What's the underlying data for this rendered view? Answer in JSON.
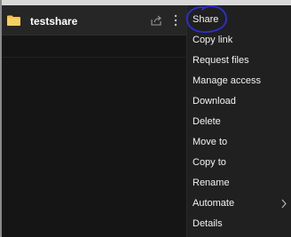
{
  "file_row": {
    "name": "testshare",
    "folder_icon": "folder-icon",
    "share_icon": "share-icon",
    "more_icon": "more-vertical-icon"
  },
  "menu": {
    "items": [
      {
        "label": "Share",
        "submenu": false
      },
      {
        "label": "Copy link",
        "submenu": false
      },
      {
        "label": "Request files",
        "submenu": false
      },
      {
        "label": "Manage access",
        "submenu": false
      },
      {
        "label": "Download",
        "submenu": false
      },
      {
        "label": "Delete",
        "submenu": false
      },
      {
        "label": "Move to",
        "submenu": false
      },
      {
        "label": "Copy to",
        "submenu": false
      },
      {
        "label": "Rename",
        "submenu": false
      },
      {
        "label": "Automate",
        "submenu": true
      },
      {
        "label": "Details",
        "submenu": false
      }
    ]
  },
  "colors": {
    "background": "#151515",
    "row_background": "#262626",
    "menu_background": "#202020",
    "folder": "#f2c14e",
    "annotation": "#2b2fd6",
    "text": "#f2f2f2"
  }
}
